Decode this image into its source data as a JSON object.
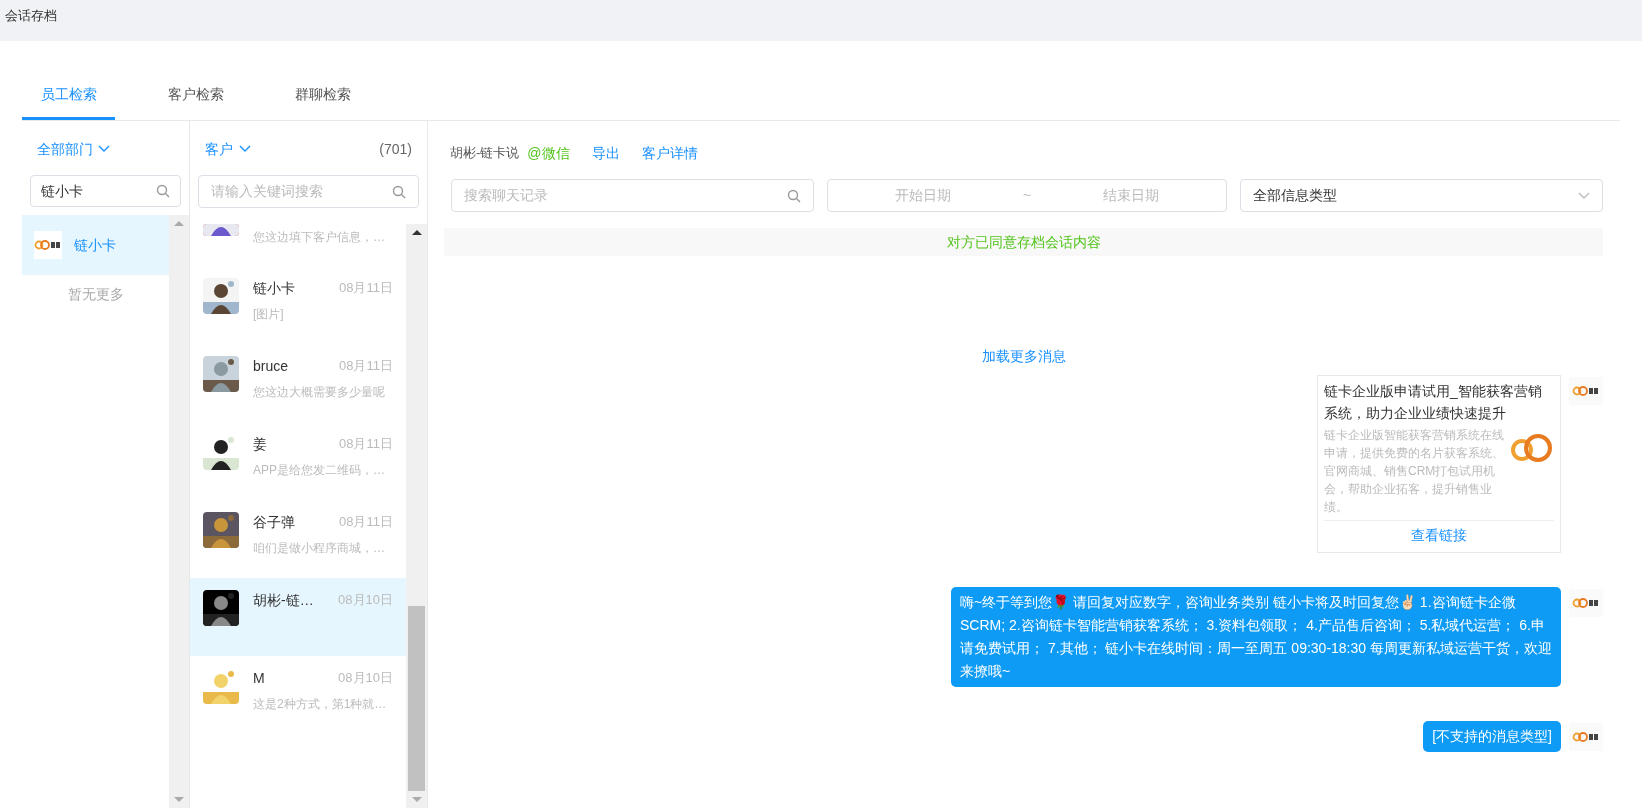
{
  "window": {
    "title": "会话存档"
  },
  "tabs": [
    {
      "label": "员工检索",
      "selected": true
    },
    {
      "label": "客户检索",
      "selected": false
    },
    {
      "label": "群聊检索",
      "selected": false
    }
  ],
  "staff_panel": {
    "department": "全部部门",
    "search": {
      "value": "链小卡"
    },
    "items": [
      {
        "name": "链小卡",
        "selected": true
      }
    ],
    "footer": "暂无更多"
  },
  "customer_panel": {
    "filter": "客户",
    "count": "(701)",
    "search": {
      "placeholder": "请输入关键词搜索"
    },
    "items": [
      {
        "preview": "您这边填下客户信息，…",
        "selected": false
      },
      {
        "name": "链小卡",
        "date": "08月11日",
        "preview": "[图片]",
        "selected": false
      },
      {
        "name": "bruce",
        "date": "08月11日",
        "preview": "您这边大概需要多少量呢",
        "selected": false
      },
      {
        "name": "姜",
        "date": "08月11日",
        "preview": "APP是给您发二维码，…",
        "selected": false
      },
      {
        "name": "谷子弹",
        "date": "08月11日",
        "preview": "咱们是做小程序商城，…",
        "selected": false
      },
      {
        "name": "胡彬-链…",
        "date": "08月10日",
        "selected": true
      },
      {
        "name": "M",
        "date": "08月10日",
        "preview": "这是2种方式，第1种就…",
        "selected": false
      }
    ]
  },
  "chat": {
    "contact": "胡彬-链卡说",
    "source": "@微信",
    "actions": [
      "导出",
      "客户详情"
    ],
    "search": {
      "placeholder": "搜索聊天记录"
    },
    "date_range": {
      "start_placeholder": "开始日期",
      "separator": "~",
      "end_placeholder": "结束日期"
    },
    "type_select": {
      "value": "全部信息类型"
    },
    "notice": "对方已同意存档会话内容",
    "load_more": "加载更多消息",
    "messages": [
      {
        "kind": "link",
        "title": "链卡企业版申请试用_智能获客营销系统，助力企业业绩快速提升",
        "description": "链卡企业版智能获客营销系统在线申请，提供免费的名片获客系统、官网商城、销售CRM打包试用机会，帮助企业拓客，提升销售业绩。",
        "link": "查看链接"
      },
      {
        "kind": "text",
        "text": "嗨~终于等到您🌹 请回复对应数字，咨询业务类别 链小卡将及时回复您✌🏻 1.咨询链卡企微SCRM; 2.咨询链卡智能营销获客系统； 3.资料包领取； 4.产品售后咨询； 5.私域代运营； 6.申请免费试用； 7.其他； 链小卡在线时间：周一至周五 09:30-18:30 每周更新私域运营干货，欢迎来撩哦~"
      },
      {
        "kind": "text",
        "text": "[不支持的消息类型]"
      }
    ]
  }
}
